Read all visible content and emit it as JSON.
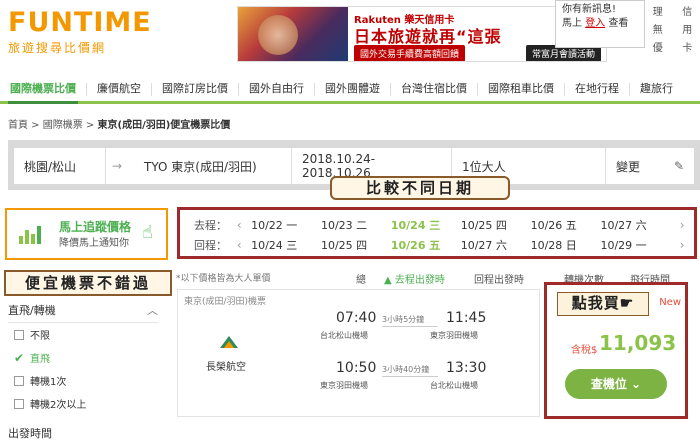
{
  "header": {
    "logo": "FUNTIME",
    "logo_sub": "旅遊搜尋比價網",
    "ad": {
      "brand": "Rakuten 樂天信用卡",
      "title": "日本旅遊就再“這張",
      "strip1": "國外交易手續費高額回饋",
      "strip2": "常富月會讀活動"
    },
    "notice": {
      "line1": "你有新訊息!",
      "line2a": "馬上 ",
      "login": "登入",
      "line2b": " 查看"
    },
    "right_links": [
      "信",
      "理",
      "用",
      "財",
      "卡",
      "無",
      "",
      "優"
    ]
  },
  "nav": {
    "items": [
      "國際機票比價",
      "廉價航空",
      "國際訂房比價",
      "國外自由行",
      "國外團體遊",
      "台灣住宿比價",
      "國際租車比價",
      "在地行程",
      "趣旅行"
    ]
  },
  "breadcrumb": {
    "home": "首頁",
    "sep": " > ",
    "cat": "國際機票",
    "current": "東京(成田/羽田)便宜機票比價"
  },
  "search": {
    "origin": "桃園/松山",
    "arrow": "→",
    "dest": "TYO 東京(成田/羽田)",
    "dates": "2018.10.24-2018.10.26",
    "pax": "1位大人",
    "change": "變更",
    "edit_glyph": "✎"
  },
  "alert": {
    "title": "馬上追蹤價格",
    "sub": "降價馬上通知你",
    "hand": "☝"
  },
  "annotations": {
    "compare_dates": "比較不同日期",
    "cheap": "便宜機票不錯過",
    "click_buy": "點我買☛"
  },
  "dates": {
    "out_label": "去程：",
    "ret_label": "回程：",
    "out": [
      "10/22 一",
      "10/23 二",
      "10/24 三",
      "10/25 四",
      "10/26 五",
      "10/27 六"
    ],
    "ret": [
      "10/24 三",
      "10/25 四",
      "10/26 五",
      "10/27 六",
      "10/28 日",
      "10/29 一"
    ],
    "selected_index": 2,
    "prev": "‹",
    "next": "›"
  },
  "results": {
    "note": "*以下價格皆為大人單價",
    "cols": [
      "總",
      "▲ 去程出發時",
      "回程出發時",
      "轉機次數",
      "飛行時間"
    ],
    "cols2": [
      "價",
      "間",
      "間"
    ]
  },
  "filters": {
    "head": "直飛/轉機",
    "head_arrow": "︿",
    "options": [
      {
        "label": "不限",
        "checked": false
      },
      {
        "label": "直飛",
        "checked": true
      },
      {
        "label": "轉機1次",
        "checked": false
      },
      {
        "label": "轉機2次以上",
        "checked": false
      }
    ],
    "head2": "出發時間",
    "check_glyph": "✔"
  },
  "card": {
    "top": "東京(成田/羽田)機票",
    "airline": "長榮航空",
    "legs": [
      {
        "dep": "07:40",
        "arr": "11:45",
        "dur": "3小時5分鐘",
        "from": "台北松山機場",
        "to": "東京羽田機場"
      },
      {
        "dep": "10:50",
        "arr": "13:30",
        "dur": "3小時40分鐘",
        "from": "東京羽田機場",
        "to": "台北松山機場"
      }
    ]
  },
  "price": {
    "new": "New",
    "label": "含稅$",
    "value": "11,093",
    "buy": "查機位 ⌄"
  }
}
